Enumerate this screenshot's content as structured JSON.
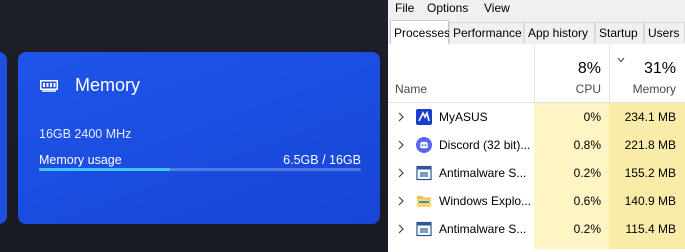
{
  "colors": {
    "card_blue": "#1d4fe0",
    "bar_fill": "#3fc7ff",
    "cpu_heat": "#fff4c4",
    "mem_heat": "#f9eca8"
  },
  "memory_card": {
    "title": "Memory",
    "icon": "memory-module-icon",
    "spec": "16GB 2400 MHz",
    "usage_label": "Memory usage",
    "usage_value": "6.5GB / 16GB",
    "usage_fraction": 0.40625
  },
  "task_manager": {
    "menu": [
      "File",
      "Options",
      "View"
    ],
    "tabs": [
      "Processes",
      "Performance",
      "App history",
      "Startup",
      "Users"
    ],
    "active_tab": "Processes",
    "columns": {
      "name": "Name",
      "cpu_label": "CPU",
      "cpu_total": "8%",
      "memory_label": "Memory",
      "memory_total": "31%",
      "sort_icon": "chevron-down-icon"
    },
    "processes": [
      {
        "name": "MyASUS",
        "cpu": "0%",
        "memory": "234.1 MB",
        "icon": "myasus-icon"
      },
      {
        "name": "Discord (32 bit)...",
        "cpu": "0.8%",
        "memory": "221.8 MB",
        "icon": "discord-icon"
      },
      {
        "name": "Antimalware S...",
        "cpu": "0.2%",
        "memory": "155.2 MB",
        "icon": "service-window-icon"
      },
      {
        "name": "Windows Explo...",
        "cpu": "0.6%",
        "memory": "140.9 MB",
        "icon": "folder-icon"
      },
      {
        "name": "Antimalware S...",
        "cpu": "0.2%",
        "memory": "115.4 MB",
        "icon": "service-window-icon"
      }
    ]
  }
}
